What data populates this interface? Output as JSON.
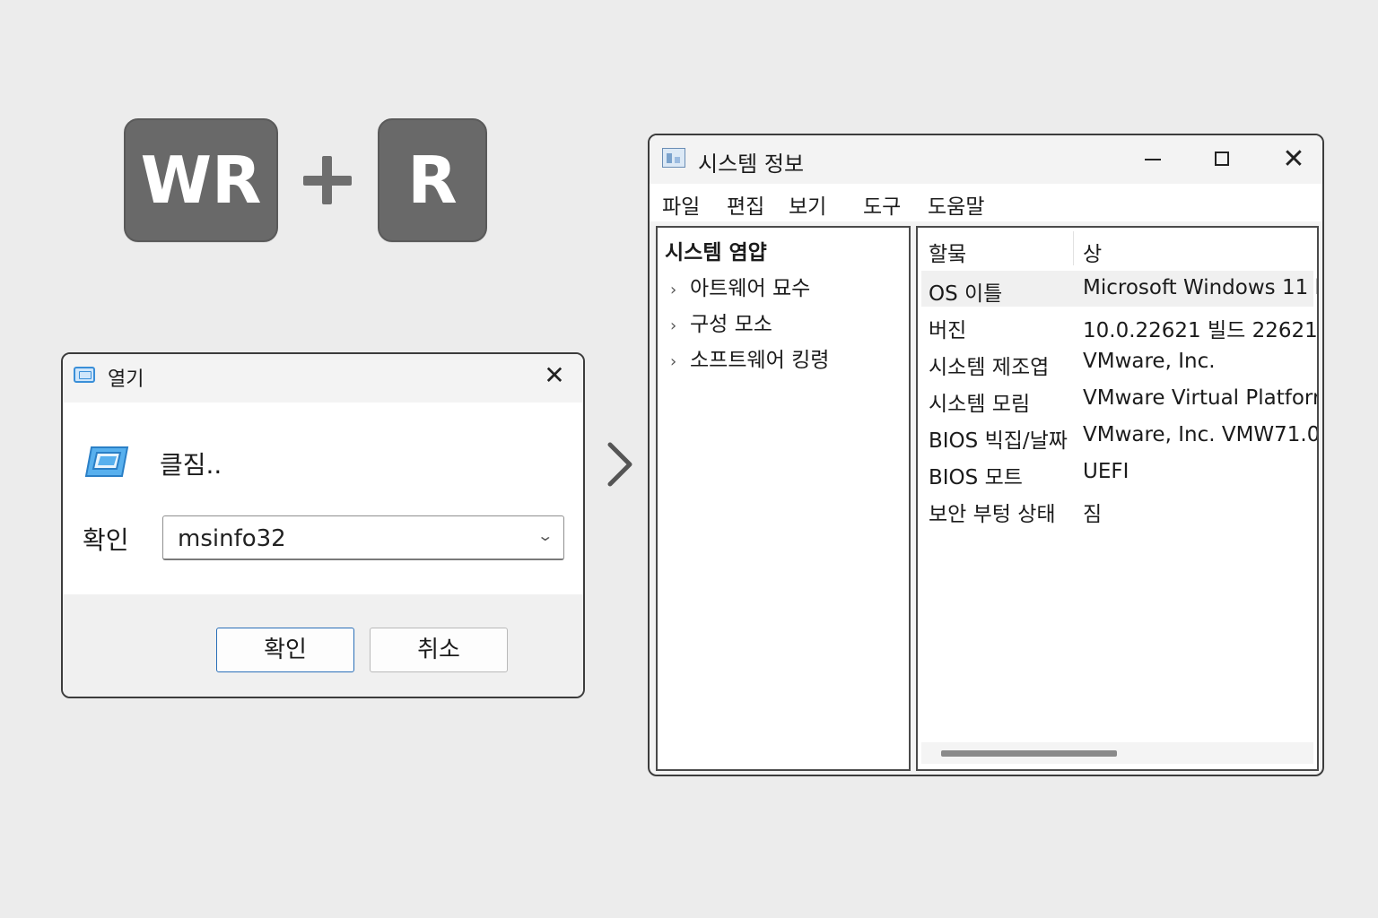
{
  "shortcut": {
    "key1": "WR",
    "key2": "R"
  },
  "run_dialog": {
    "title": "열기",
    "description": "클짐..",
    "open_label": "확인",
    "input_value": "msinfo32",
    "ok_label": "확인",
    "cancel_label": "취소"
  },
  "sysinfo": {
    "title": "시스템 정보",
    "menu": [
      "파일",
      "편집",
      "보기",
      "도구",
      "도움말"
    ],
    "tree": {
      "root": "시스템 염얍",
      "items": [
        "아트웨어 묘수",
        "구성 모소",
        "소프트웨어 킹령"
      ]
    },
    "columns": {
      "item": "할뭌",
      "value": "상"
    },
    "rows": [
      {
        "item": "OS 이틀",
        "value": "Microsoft Windows 11 l"
      },
      {
        "item": "버진",
        "value": "10.0.22621 빌드 22621"
      },
      {
        "item": "시소템 제조엽",
        "value": "VMware, Inc."
      },
      {
        "item": "시소템 모림",
        "value": "VMware Virtual Platforr"
      },
      {
        "item": "BIOS 빅집/날짜",
        "value": "VMware, Inc. VMW71.0("
      },
      {
        "item": "BIOS 모트",
        "value": "UEFI"
      },
      {
        "item": "보안 부텅 상태",
        "value": "짐"
      }
    ]
  },
  "colors": {
    "background": "#ececec",
    "key": "#696969",
    "accent": "#2a6fb8"
  },
  "icons": {
    "run_title": "run-dialog-icon",
    "run_app": "run-app-icon",
    "sys_title": "system-info-icon",
    "next": "chevron-right-icon"
  }
}
